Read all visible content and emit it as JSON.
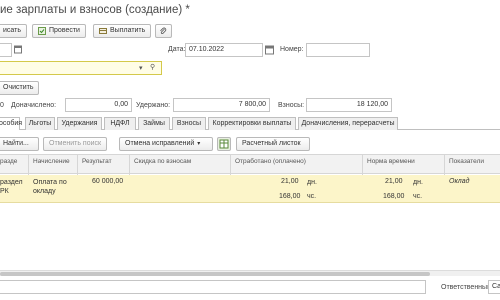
{
  "window": {
    "title": "ие зарплаты и взносов (создание) *"
  },
  "toolbar": {
    "write_label": "исать",
    "post_label": "Провести",
    "pay_label": "Выплатить"
  },
  "header": {
    "date_label": "Дата:",
    "date_value": "07.10.2022",
    "number_label": "Номер:",
    "number_value": "",
    "clear_label": "Очистить"
  },
  "totals": {
    "first_value": "0",
    "accrued_label": "Доначислено:",
    "accrued_value": "0,00",
    "withheld_label": "Удержано:",
    "withheld_value": "7 800,00",
    "contrib_label": "Взносы:",
    "contrib_value": "18 120,00"
  },
  "tabs": [
    {
      "label": "особия"
    },
    {
      "label": "Льготы"
    },
    {
      "label": "Удержания"
    },
    {
      "label": "НДФЛ"
    },
    {
      "label": "Займы"
    },
    {
      "label": "Взносы"
    },
    {
      "label": "Корректировки выплаты"
    },
    {
      "label": "Доначисления, перерасчеты"
    }
  ],
  "table_toolbar": {
    "find_label": "Найти...",
    "cancel_search_label": "Отменить поиск",
    "cancel_fix_label": "Отмена исправлений",
    "payslip_label": "Расчетный листок"
  },
  "columns": {
    "c1_line1": "разде",
    "c1_line2": "",
    "c2": "Начисление",
    "c3": "Результат",
    "c4": "Скидка по взносам",
    "c5": "Отработано (оплачено)",
    "c6": "Норма времени",
    "c7": "Показатели"
  },
  "row": {
    "dept_line1": "раздел",
    "dept_line2": "РК",
    "accrual_line1": "Оплата по",
    "accrual_line2": "окладу",
    "result": "60 000,00",
    "worked_days": "21,00",
    "worked_days_unit": "дн.",
    "worked_hours": "168,00",
    "worked_hours_unit": "чс.",
    "norm_days": "21,00",
    "norm_days_unit": "дн.",
    "norm_hours": "168,00",
    "norm_hours_unit": "чс.",
    "indicator": "Оклад"
  },
  "footer": {
    "responsible_label": "Ответственный:",
    "responsible_value": "Са"
  },
  "colors": {
    "row_highlight": "#fcf5c9",
    "yellow_field": "#fffde6"
  }
}
